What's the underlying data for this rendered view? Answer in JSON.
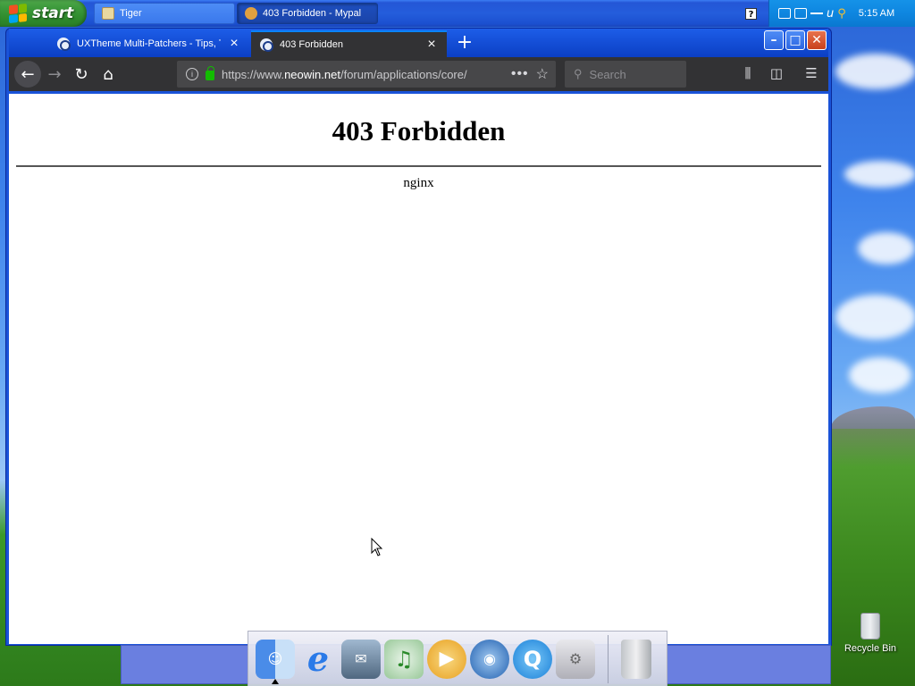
{
  "taskbar": {
    "start_label": "start",
    "tasks": [
      {
        "label": "Tiger",
        "icon": "folder-icon"
      },
      {
        "label": "403 Forbidden - Mypal",
        "icon": "mypal-icon"
      }
    ],
    "clock": "5:15 AM"
  },
  "browser": {
    "tabs": [
      {
        "title": "UXTheme Multi-Patchers - Tips, Tw",
        "active": false
      },
      {
        "title": "403 Forbidden",
        "active": true
      }
    ],
    "url_prefix": "https://www.",
    "url_domain": "neowin.net",
    "url_path": "/forum/applications/core/",
    "search_placeholder": "Search"
  },
  "page": {
    "heading": "403 Forbidden",
    "server": "nginx"
  },
  "desktop": {
    "recycle_bin_label": "Recycle Bin"
  },
  "dock": {
    "items": [
      "finder-icon",
      "internet-explorer-icon",
      "mail-icon",
      "itunes-icon",
      "quicktime-icon",
      "dvd-player-icon",
      "quicktime-q-icon",
      "system-preferences-icon",
      "trash-icon"
    ]
  },
  "colors": {
    "taskbar": "#245ddc",
    "start": "#3c9a3b",
    "accent": "#0a84ff",
    "toolbar": "#323234"
  }
}
